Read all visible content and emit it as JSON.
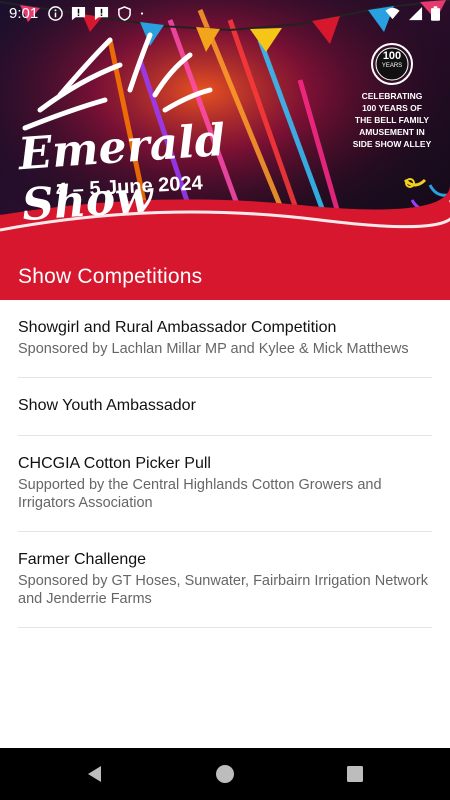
{
  "status_bar": {
    "time": "9:01",
    "icons_left": [
      "info-icon",
      "alert-message-icon",
      "alert-message-icon",
      "shield-icon",
      "dot-icon"
    ],
    "icons_right": [
      "wifi-icon",
      "signal-icon",
      "battery-icon"
    ]
  },
  "banner": {
    "logo_text": "Emerald Show",
    "dates": "4 – 5 June 2024",
    "badge_number": "100",
    "badge_sub": "YEARS",
    "celebrating_lines": [
      "CELEBRATING",
      "100 YEARS OF",
      "THE BELL FAMILY",
      "AMUSEMENT IN",
      "SIDE SHOW ALLEY"
    ]
  },
  "header": {
    "title": "Show Competitions"
  },
  "competitions": [
    {
      "title": "Showgirl and Rural Ambassador Competition",
      "subtitle": "Sponsored by Lachlan Millar MP and Kylee & Mick Matthews"
    },
    {
      "title": "Show Youth Ambassador",
      "subtitle": ""
    },
    {
      "title": "CHCGIA Cotton Picker Pull",
      "subtitle": "Supported by the Central Highlands Cotton Growers and Irrigators Association"
    },
    {
      "title": "Farmer Challenge",
      "subtitle": "Sponsored by GT Hoses, Sunwater, Fairbairn Irrigation Network and Jenderrie Farms"
    }
  ],
  "nav": [
    "back-icon",
    "home-icon",
    "recents-icon"
  ],
  "colors": {
    "header_red": "#d6172e",
    "banner_bg": "#0b0a16",
    "nav_bg": "#000000"
  }
}
